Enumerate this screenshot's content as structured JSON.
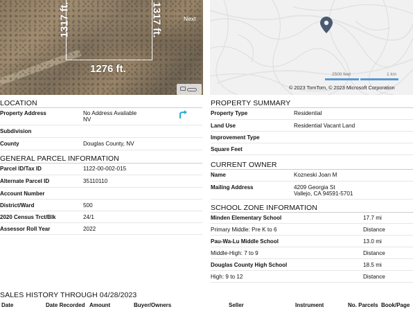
{
  "satellite": {
    "dim_left": "1317 ft.",
    "dim_right": "1317 ft.",
    "dim_bottom": "1276 ft.",
    "next_label": "Next"
  },
  "map": {
    "scale_feet": "2500 feet",
    "scale_km": "1 km",
    "copyright": "© 2023 TomTom, © 2023 Microsoft Corporation",
    "accent_color": "#5b9ad6",
    "pin_color": "#4a5a70"
  },
  "location": {
    "title": "LOCATION",
    "rows": [
      {
        "label": "Property Address",
        "value": "No Address Available",
        "value2": "NV"
      },
      {
        "label": "Subdivision",
        "value": ""
      },
      {
        "label": "County",
        "value": "Douglas County, NV"
      }
    ]
  },
  "parcel": {
    "title": "GENERAL PARCEL INFORMATION",
    "rows": [
      {
        "label": "Parcel ID/Tax ID",
        "value": "1122-00-002-015"
      },
      {
        "label": "Alternate Parcel ID",
        "value": "35110110"
      },
      {
        "label": "Account Number",
        "value": ""
      },
      {
        "label": "District/Ward",
        "value": "500"
      },
      {
        "label": "2020 Census Trct/Blk",
        "value": "24/1"
      },
      {
        "label": "Assessor Roll Year",
        "value": "2022"
      }
    ]
  },
  "summary": {
    "title": "PROPERTY SUMMARY",
    "rows": [
      {
        "label": "Property Type",
        "value": "Residential"
      },
      {
        "label": "Land Use",
        "value": "Residential Vacant Land"
      },
      {
        "label": "Improvement Type",
        "value": ""
      },
      {
        "label": "Square Feet",
        "value": ""
      }
    ]
  },
  "owner": {
    "title": "CURRENT OWNER",
    "rows": [
      {
        "label": "Name",
        "value": "Kozneski Joan M"
      },
      {
        "label": "Mailing Address",
        "value": "4209 Georgia St",
        "value2": "Vallejo, CA 94591-5701"
      }
    ]
  },
  "schools": {
    "title": "SCHOOL ZONE INFORMATION",
    "rows": [
      {
        "name": "Minden Elementary School",
        "dist": "17.7 mi",
        "grades": "Primary Middle: Pre K to 6",
        "dist_label": "Distance"
      },
      {
        "name": "Pau-Wa-Lu Middle School",
        "dist": "13.0 mi",
        "grades": "Middle-High: 7 to 9",
        "dist_label": "Distance"
      },
      {
        "name": "Douglas County High School",
        "dist": "18.5 mi",
        "grades": "High: 9 to 12",
        "dist_label": "Distance"
      }
    ]
  },
  "sales": {
    "title": "SALES HISTORY THROUGH 04/28/2023",
    "columns": [
      "Date",
      "Date Recorded",
      "Amount",
      "Buyer/Owners",
      "Seller",
      "Instrument",
      "No. Parcels",
      "Book/Page"
    ]
  }
}
